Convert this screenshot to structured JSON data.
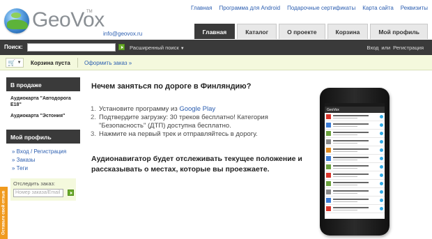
{
  "brand": {
    "name": "GeoVox",
    "tm": "TM",
    "email": "info@geovox.ru"
  },
  "top_links": [
    "Главная",
    "Программа для Android",
    "Подарочные сертификаты",
    "Карта сайта",
    "Реквизиты"
  ],
  "tabs": [
    {
      "label": "Главная",
      "active": true
    },
    {
      "label": "Каталог",
      "active": false
    },
    {
      "label": "О проекте",
      "active": false
    },
    {
      "label": "Корзина",
      "active": false
    },
    {
      "label": "Мой профиль",
      "active": false
    }
  ],
  "search": {
    "label": "Поиск:",
    "value": "",
    "advanced": "Расширенный поиск"
  },
  "auth": {
    "login": "Вход",
    "or": "или",
    "register": "Регистрация"
  },
  "cart": {
    "empty_label": "Корзина пуста",
    "checkout_label": "Оформить заказ »"
  },
  "sidebar": {
    "on_sale_title": "В продаже",
    "on_sale_items": [
      "Аудиокарта \"Автодорога Е18\"",
      "Аудиокарта \"Эстония\""
    ],
    "profile_title": "Мой профиль",
    "profile_links": [
      "Вход / Регистрация",
      "Заказы",
      "Теги"
    ],
    "track_label": "Отследить заказ:",
    "track_placeholder": "Номер заказа/Email"
  },
  "feedback_tab": "Оставьте свой отзыв",
  "main": {
    "title": "Нечем заняться по дороге в Финляндию?",
    "steps": [
      {
        "num": "1.",
        "text_before": "Установите программу из ",
        "link": "Google Play",
        "text_after": ""
      },
      {
        "num": "2.",
        "text_before": "Подтвердите загрузку: 30 треков бесплатно! Категория \"Безопасность\" (ДТП) доступна бесплатно.",
        "link": "",
        "text_after": ""
      },
      {
        "num": "3.",
        "text_before": "Нажмите на первый трек и отправляйтесь в дорогу.",
        "link": "",
        "text_after": ""
      }
    ],
    "description": "Аудионавигатор будет отслеживать текущее положение и рассказывать о местах, которые вы проезжаете."
  },
  "colors": {
    "dark_bar": "#3a3a3a",
    "link": "#2a5db0",
    "cart_bg": "#f4f9dd",
    "go_button": "#6cad2b",
    "feedback": "#f09a1e"
  },
  "icons": {
    "cart": "cart-icon",
    "go": "arrow-right-icon",
    "phone": "android-phone-image"
  }
}
